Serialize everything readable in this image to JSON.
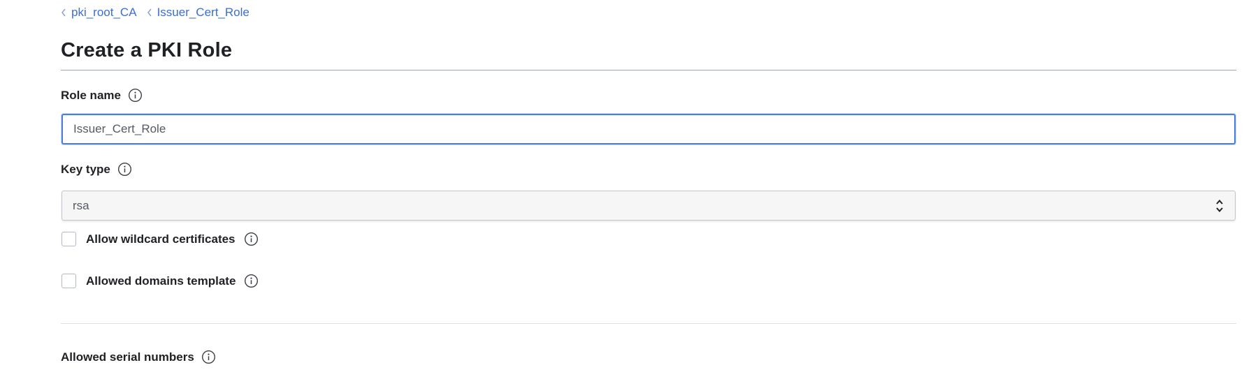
{
  "breadcrumb": {
    "items": [
      {
        "label": "pki_root_CA"
      },
      {
        "label": "Issuer_Cert_Role"
      }
    ]
  },
  "page": {
    "title": "Create a PKI Role"
  },
  "form": {
    "role_name": {
      "label": "Role name",
      "value": "Issuer_Cert_Role"
    },
    "key_type": {
      "label": "Key type",
      "selected": "rsa"
    },
    "allow_wildcard": {
      "label": "Allow wildcard certificates",
      "checked": false
    },
    "allowed_domains_template": {
      "label": "Allowed domains template",
      "checked": false
    },
    "allowed_serial_numbers": {
      "label": "Allowed serial numbers"
    }
  },
  "icons": {
    "chevron": "chevron-left-icon",
    "info": "info-circle-icon",
    "select": "select-arrows-icon"
  },
  "colors": {
    "link": "#3b6ed6",
    "focus_border": "#4a7fe0",
    "text": "#1f2124"
  }
}
